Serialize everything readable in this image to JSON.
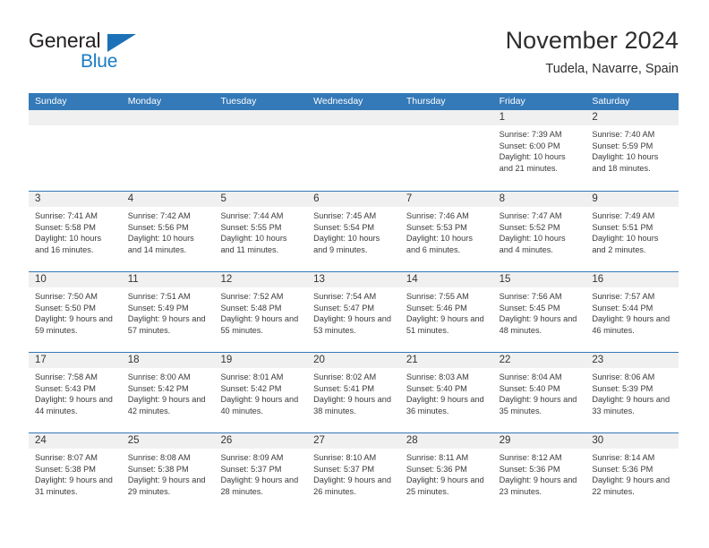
{
  "logo": {
    "word_one": "General",
    "word_two": "Blue",
    "triangle_color": "#1d71b8",
    "blue_color": "#1a7bc4"
  },
  "header": {
    "title": "November 2024",
    "subtitle": "Tudela, Navarre, Spain"
  },
  "theme": {
    "header_blue": "#3479b8",
    "day_band_gray": "#f0f0f0",
    "text_color": "#3a3a3a"
  },
  "weekdays": [
    "Sunday",
    "Monday",
    "Tuesday",
    "Wednesday",
    "Thursday",
    "Friday",
    "Saturday"
  ],
  "labels": {
    "sunrise": "Sunrise:",
    "sunset": "Sunset:",
    "daylight": "Daylight:"
  },
  "weeks": [
    [
      {
        "day": "",
        "empty": true
      },
      {
        "day": "",
        "empty": true
      },
      {
        "day": "",
        "empty": true
      },
      {
        "day": "",
        "empty": true
      },
      {
        "day": "",
        "empty": true
      },
      {
        "day": "1",
        "sunrise": "Sunrise: 7:39 AM",
        "sunset": "Sunset: 6:00 PM",
        "daylight": "Daylight: 10 hours and 21 minutes."
      },
      {
        "day": "2",
        "sunrise": "Sunrise: 7:40 AM",
        "sunset": "Sunset: 5:59 PM",
        "daylight": "Daylight: 10 hours and 18 minutes."
      }
    ],
    [
      {
        "day": "3",
        "sunrise": "Sunrise: 7:41 AM",
        "sunset": "Sunset: 5:58 PM",
        "daylight": "Daylight: 10 hours and 16 minutes."
      },
      {
        "day": "4",
        "sunrise": "Sunrise: 7:42 AM",
        "sunset": "Sunset: 5:56 PM",
        "daylight": "Daylight: 10 hours and 14 minutes."
      },
      {
        "day": "5",
        "sunrise": "Sunrise: 7:44 AM",
        "sunset": "Sunset: 5:55 PM",
        "daylight": "Daylight: 10 hours and 11 minutes."
      },
      {
        "day": "6",
        "sunrise": "Sunrise: 7:45 AM",
        "sunset": "Sunset: 5:54 PM",
        "daylight": "Daylight: 10 hours and 9 minutes."
      },
      {
        "day": "7",
        "sunrise": "Sunrise: 7:46 AM",
        "sunset": "Sunset: 5:53 PM",
        "daylight": "Daylight: 10 hours and 6 minutes."
      },
      {
        "day": "8",
        "sunrise": "Sunrise: 7:47 AM",
        "sunset": "Sunset: 5:52 PM",
        "daylight": "Daylight: 10 hours and 4 minutes."
      },
      {
        "day": "9",
        "sunrise": "Sunrise: 7:49 AM",
        "sunset": "Sunset: 5:51 PM",
        "daylight": "Daylight: 10 hours and 2 minutes."
      }
    ],
    [
      {
        "day": "10",
        "sunrise": "Sunrise: 7:50 AM",
        "sunset": "Sunset: 5:50 PM",
        "daylight": "Daylight: 9 hours and 59 minutes."
      },
      {
        "day": "11",
        "sunrise": "Sunrise: 7:51 AM",
        "sunset": "Sunset: 5:49 PM",
        "daylight": "Daylight: 9 hours and 57 minutes."
      },
      {
        "day": "12",
        "sunrise": "Sunrise: 7:52 AM",
        "sunset": "Sunset: 5:48 PM",
        "daylight": "Daylight: 9 hours and 55 minutes."
      },
      {
        "day": "13",
        "sunrise": "Sunrise: 7:54 AM",
        "sunset": "Sunset: 5:47 PM",
        "daylight": "Daylight: 9 hours and 53 minutes."
      },
      {
        "day": "14",
        "sunrise": "Sunrise: 7:55 AM",
        "sunset": "Sunset: 5:46 PM",
        "daylight": "Daylight: 9 hours and 51 minutes."
      },
      {
        "day": "15",
        "sunrise": "Sunrise: 7:56 AM",
        "sunset": "Sunset: 5:45 PM",
        "daylight": "Daylight: 9 hours and 48 minutes."
      },
      {
        "day": "16",
        "sunrise": "Sunrise: 7:57 AM",
        "sunset": "Sunset: 5:44 PM",
        "daylight": "Daylight: 9 hours and 46 minutes."
      }
    ],
    [
      {
        "day": "17",
        "sunrise": "Sunrise: 7:58 AM",
        "sunset": "Sunset: 5:43 PM",
        "daylight": "Daylight: 9 hours and 44 minutes."
      },
      {
        "day": "18",
        "sunrise": "Sunrise: 8:00 AM",
        "sunset": "Sunset: 5:42 PM",
        "daylight": "Daylight: 9 hours and 42 minutes."
      },
      {
        "day": "19",
        "sunrise": "Sunrise: 8:01 AM",
        "sunset": "Sunset: 5:42 PM",
        "daylight": "Daylight: 9 hours and 40 minutes."
      },
      {
        "day": "20",
        "sunrise": "Sunrise: 8:02 AM",
        "sunset": "Sunset: 5:41 PM",
        "daylight": "Daylight: 9 hours and 38 minutes."
      },
      {
        "day": "21",
        "sunrise": "Sunrise: 8:03 AM",
        "sunset": "Sunset: 5:40 PM",
        "daylight": "Daylight: 9 hours and 36 minutes."
      },
      {
        "day": "22",
        "sunrise": "Sunrise: 8:04 AM",
        "sunset": "Sunset: 5:40 PM",
        "daylight": "Daylight: 9 hours and 35 minutes."
      },
      {
        "day": "23",
        "sunrise": "Sunrise: 8:06 AM",
        "sunset": "Sunset: 5:39 PM",
        "daylight": "Daylight: 9 hours and 33 minutes."
      }
    ],
    [
      {
        "day": "24",
        "sunrise": "Sunrise: 8:07 AM",
        "sunset": "Sunset: 5:38 PM",
        "daylight": "Daylight: 9 hours and 31 minutes."
      },
      {
        "day": "25",
        "sunrise": "Sunrise: 8:08 AM",
        "sunset": "Sunset: 5:38 PM",
        "daylight": "Daylight: 9 hours and 29 minutes."
      },
      {
        "day": "26",
        "sunrise": "Sunrise: 8:09 AM",
        "sunset": "Sunset: 5:37 PM",
        "daylight": "Daylight: 9 hours and 28 minutes."
      },
      {
        "day": "27",
        "sunrise": "Sunrise: 8:10 AM",
        "sunset": "Sunset: 5:37 PM",
        "daylight": "Daylight: 9 hours and 26 minutes."
      },
      {
        "day": "28",
        "sunrise": "Sunrise: 8:11 AM",
        "sunset": "Sunset: 5:36 PM",
        "daylight": "Daylight: 9 hours and 25 minutes."
      },
      {
        "day": "29",
        "sunrise": "Sunrise: 8:12 AM",
        "sunset": "Sunset: 5:36 PM",
        "daylight": "Daylight: 9 hours and 23 minutes."
      },
      {
        "day": "30",
        "sunrise": "Sunrise: 8:14 AM",
        "sunset": "Sunset: 5:36 PM",
        "daylight": "Daylight: 9 hours and 22 minutes."
      }
    ]
  ]
}
